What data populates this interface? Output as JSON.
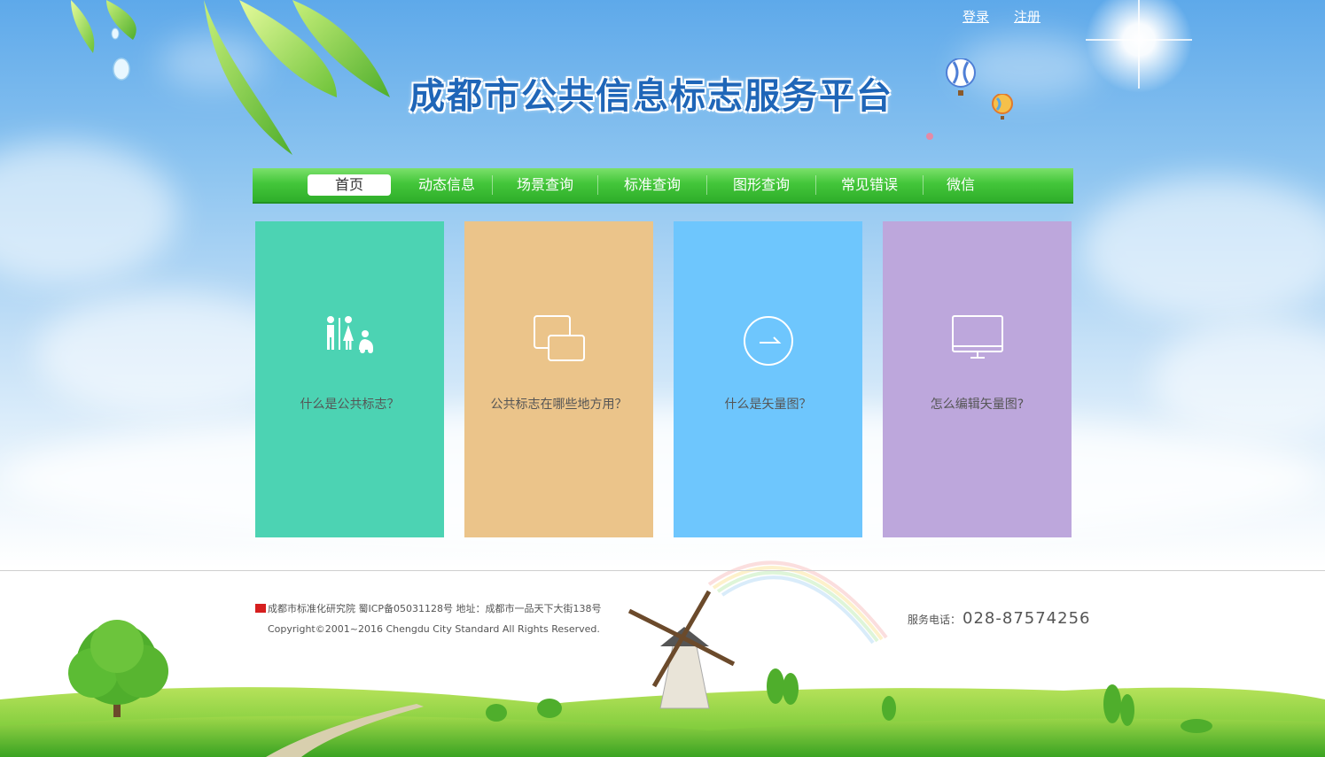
{
  "header": {
    "site_title": "成都市公共信息标志服务平台",
    "login_link": "登录",
    "register_link": "注册"
  },
  "nav": {
    "items": [
      {
        "label": "首页",
        "active": true
      },
      {
        "label": "动态信息",
        "active": false
      },
      {
        "label": "场景查询",
        "active": false
      },
      {
        "label": "标准查询",
        "active": false
      },
      {
        "label": "图形查询",
        "active": false
      },
      {
        "label": "常见错误",
        "active": false
      },
      {
        "label": "微信",
        "active": false
      }
    ]
  },
  "cards": [
    {
      "label": "什么是公共标志？",
      "icon": "restroom-icon",
      "color": "#4cd3b3"
    },
    {
      "label": "公共标志在哪些地方用？",
      "icon": "windows-icon",
      "color": "#ebc48a"
    },
    {
      "label": "什么是矢量图？",
      "icon": "arrow-circle-icon",
      "color": "#6ec6fd"
    },
    {
      "label": "怎么编辑矢量图?",
      "icon": "monitor-icon",
      "color": "#bda7dc"
    }
  ],
  "footer": {
    "org_line": "成都市标准化研究院 蜀ICP备05031128号 地址：成都市一品天下大街138号",
    "copyright": "Copyright©2001~2016 Chengdu City Standard All Rights Reserved.",
    "phone_label": "服务电话：",
    "phone_number": "028-87574256"
  },
  "colors": {
    "nav_green": "#43c63a",
    "title_blue": "#1f66b8"
  }
}
